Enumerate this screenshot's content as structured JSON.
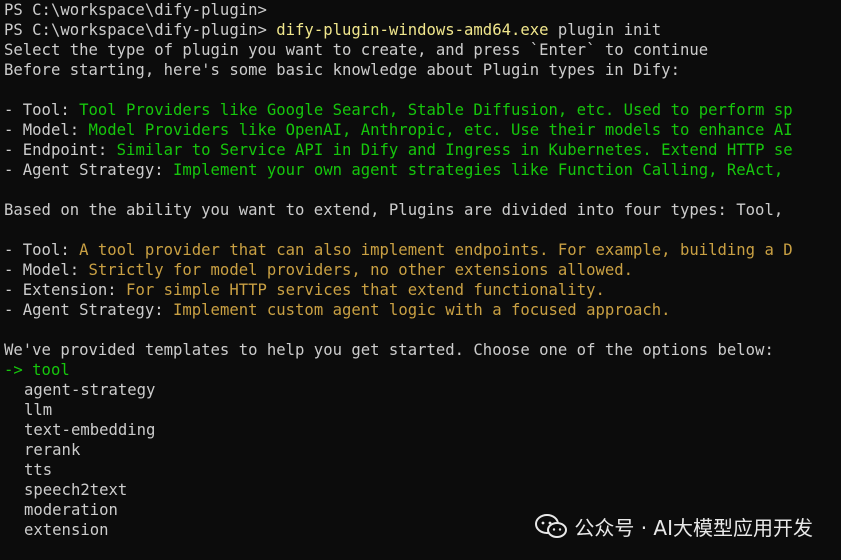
{
  "prompt": {
    "line1": "PS C:\\workspace\\dify-plugin>",
    "line2": "PS C:\\workspace\\dify-plugin>",
    "command": "dify-plugin-windows-amd64.exe",
    "args": "plugin init"
  },
  "intro": [
    "Select the type of plugin you want to create, and press `Enter` to continue",
    "Before starting, here's some basic knowledge about Plugin types in Dify:"
  ],
  "types_section1": [
    {
      "label": "- Tool:",
      "desc": " Tool Providers like Google Search, Stable Diffusion, etc. Used to perform sp"
    },
    {
      "label": "- Model:",
      "desc": " Model Providers like OpenAI, Anthropic, etc. Use their models to enhance AI"
    },
    {
      "label": "- Endpoint:",
      "desc": " Similar to Service API in Dify and Ingress in Kubernetes. Extend HTTP se"
    },
    {
      "label": "- Agent Strategy:",
      "desc": " Implement your own agent strategies like Function Calling, ReAct,"
    }
  ],
  "ability_text": "Based on the ability you want to extend, Plugins are divided into four types: Tool,",
  "types_section2": [
    {
      "label": "- Tool:",
      "desc": " A tool provider that can also implement endpoints. For example, building a D"
    },
    {
      "label": "- Model:",
      "desc": " Strictly for model providers, no other extensions allowed."
    },
    {
      "label": "- Extension:",
      "desc": " For simple HTTP services that extend functionality."
    },
    {
      "label": "- Agent Strategy:",
      "desc": " Implement custom agent logic with a focused approach."
    }
  ],
  "templates_text": "We've provided templates to help you get started. Choose one of the options below:",
  "options": {
    "selected": "-> tool",
    "items": [
      "agent-strategy",
      "llm",
      "text-embedding",
      "rerank",
      "tts",
      "speech2text",
      "moderation",
      "extension"
    ]
  },
  "watermark": {
    "text": "公众号 · AI大模型应用开发",
    "icon": "wechat-icon"
  },
  "colors": {
    "background": "#0c0c0c",
    "text": "#cccccc",
    "command": "#f0e68c",
    "green": "#16c60c",
    "amber": "#c9a043"
  }
}
